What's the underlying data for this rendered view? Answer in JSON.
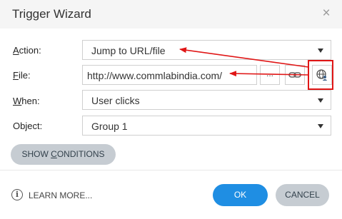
{
  "dialog": {
    "title": "Trigger Wizard",
    "close_glyph": "×"
  },
  "fields": {
    "action": {
      "label_prefix": "",
      "label_access": "A",
      "label_rest": "ction:",
      "value": "Jump to URL/file"
    },
    "file": {
      "label_access": "F",
      "label_rest": "ile:",
      "value": "http://www.commlabindia.com/",
      "browse_glyph": "..."
    },
    "when": {
      "label_access": "W",
      "label_rest": "hen:",
      "value": "User clicks"
    },
    "object": {
      "label": "Object:",
      "value": "Group 1"
    }
  },
  "buttons": {
    "show_conditions_prefix": "SHOW ",
    "show_conditions_access": "C",
    "show_conditions_rest": "ONDITIONS",
    "learn_more": "LEARN MORE...",
    "ok": "OK",
    "cancel": "CANCEL",
    "info_glyph": "i"
  },
  "icons": {
    "close": "close-icon",
    "caret": "chevron-down-icon",
    "link": "link-icon",
    "web_object": "web-object-icon",
    "info": "info-icon"
  },
  "colors": {
    "accent": "#1f8ee3",
    "secondary_button": "#c6ccd2",
    "annotation": "#e01616"
  }
}
